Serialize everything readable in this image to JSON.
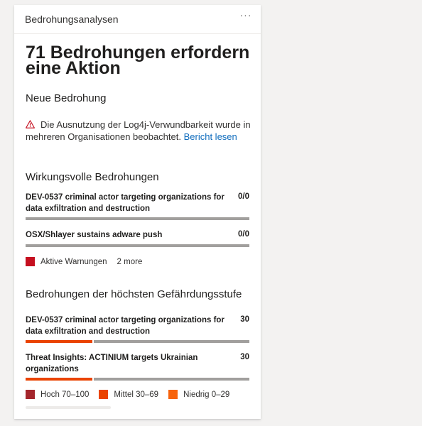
{
  "card": {
    "title": "Bedrohungsanalysen",
    "more_label": "···",
    "headline": "71 Bedrohungen erfordern eine Aktion"
  },
  "new_threat": {
    "title": "Neue Bedrohung",
    "text": "Die Ausnutzung der Log4j-Verwundbarkeit wurde in mehreren Organisationen beobachtet.",
    "link": "Bericht lesen"
  },
  "impactful": {
    "title": "Wirkungsvolle Bedrohungen",
    "items": [
      {
        "name": "DEV-0537 criminal actor targeting organizations for data exfiltration and destruction",
        "value": "0/0",
        "active_fraction": 0
      },
      {
        "name": "OSX/Shlayer sustains adware push",
        "value": "0/0",
        "active_fraction": 0
      }
    ],
    "legend": {
      "label": "Aktive Warnungen",
      "more": "2 more",
      "color": "#c50f1f"
    }
  },
  "severity": {
    "title": "Bedrohungen der höchsten Gefährdungsstufe",
    "items": [
      {
        "name": "DEV-0537 criminal actor targeting organizations for data exfiltration and destruction",
        "value": "30",
        "high_fraction": 0,
        "medium_fraction": 0.3
      },
      {
        "name": "Threat Insights: ACTINIUM targets Ukrainian organizations",
        "value": "30",
        "high_fraction": 0,
        "medium_fraction": 0.3
      }
    ],
    "legend": [
      {
        "label": "Hoch 70–100",
        "color": "#a4262c"
      },
      {
        "label": "Mittel 30–69",
        "color": "#ea4300"
      },
      {
        "label": "Niedrig 0–29",
        "color": "#f7630c"
      }
    ]
  }
}
